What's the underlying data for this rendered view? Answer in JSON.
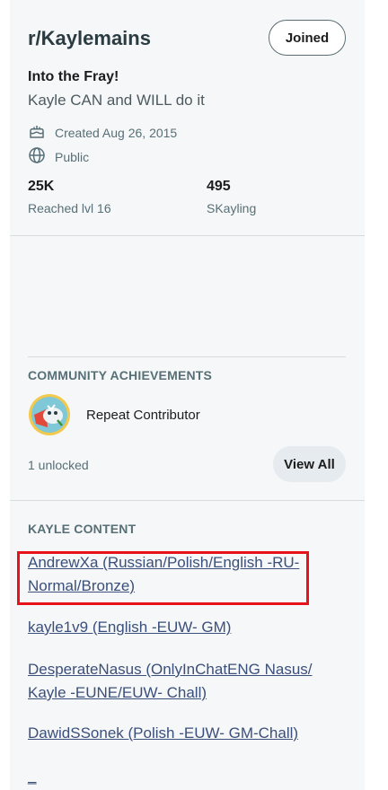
{
  "community": {
    "name": "r/Kaylemains",
    "joined_label": "Joined",
    "tagline": "Into the Fray!",
    "description": "Kayle CAN and WILL do it",
    "created": "Created Aug 26, 2015",
    "visibility": "Public"
  },
  "stats": [
    {
      "value": "25K",
      "label": "Reached lvl 16"
    },
    {
      "value": "495",
      "label": "SKayling"
    }
  ],
  "achievements": {
    "header": "COMMUNITY ACHIEVEMENTS",
    "item_label": "Repeat Contributor",
    "unlocked": "1 unlocked",
    "view_all_label": "View All"
  },
  "content": {
    "header": "KAYLE CONTENT",
    "links": [
      "AndrewXa (Russian/Polish/English -RU- Normal/Bronze)",
      "kayle1v9 (English -EUW- GM)",
      "DesperateNasus  (OnlyInChatENG Nasus/ Kayle -EUNE/EUW- Chall)",
      "DawidSSonek (Polish -EUW- GM-Chall)",
      "_"
    ]
  },
  "colors": {
    "highlight": "#e8121b",
    "link": "#3a4f7a",
    "panel": "#f6f7f8"
  }
}
